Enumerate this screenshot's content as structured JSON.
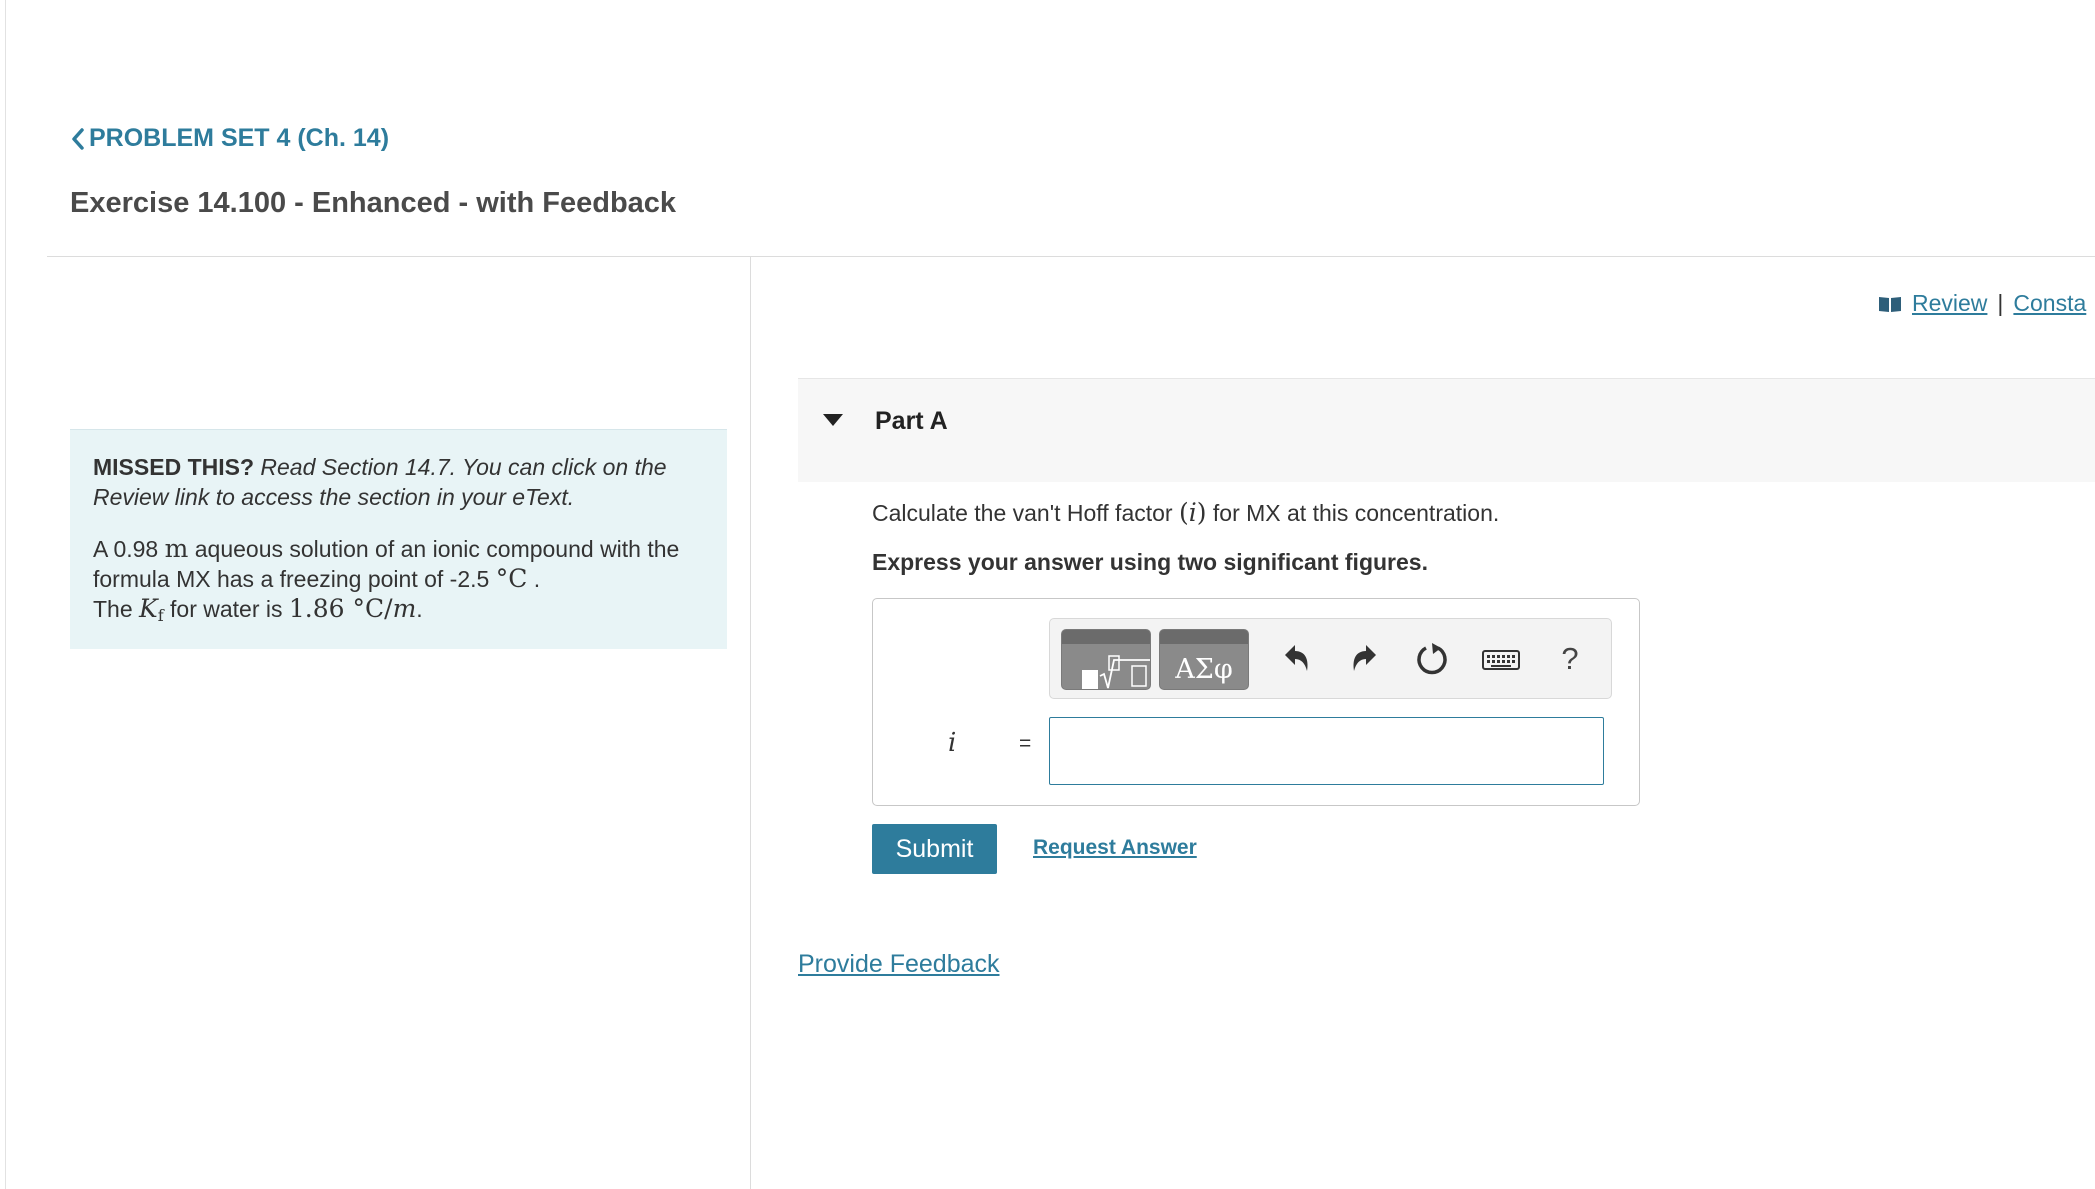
{
  "breadcrumb": {
    "label": "PROBLEM SET 4 (Ch. 14)"
  },
  "page_title": "Exercise 14.100 - Enhanced - with Feedback",
  "missed": {
    "label": "MISSED THIS?",
    "hint": "Read Section 14.7. You can click on the Review link to access the section in your eText.",
    "problem_part1": "A 0.98 ",
    "molality_unit": "m",
    "problem_part2": " aqueous solution of an ionic compound with the formula MX has a freezing point of -2.5 ",
    "fp_unit": "°C",
    "problem_part3": " .",
    "kf_prefix": "The ",
    "kf_symbol": "K",
    "kf_subscript": "f",
    "kf_middle": " for water is ",
    "kf_value": "1.86 °C/",
    "kf_value_unit": "m",
    "kf_end": "."
  },
  "review_links": {
    "review": "Review",
    "separator": "|",
    "constants": "Consta"
  },
  "part": {
    "title": "Part A"
  },
  "question": {
    "prefix": "Calculate the van't Hoff factor ",
    "symbol_open": "(",
    "symbol": "i",
    "symbol_close": ")",
    "suffix": " for MX at this concentration."
  },
  "instruction": "Express your answer using two significant figures.",
  "answer": {
    "variable": "i",
    "equals": "=",
    "value": ""
  },
  "toolbar": {
    "symbols_label": "ΑΣφ",
    "help_label": "?",
    "icons": [
      "templates-icon",
      "greek-symbols-icon",
      "undo-icon",
      "redo-icon",
      "reset-icon",
      "keyboard-icon",
      "help-icon"
    ]
  },
  "buttons": {
    "submit": "Submit",
    "request_answer": "Request Answer"
  },
  "feedback_link": "Provide Feedback",
  "colors": {
    "accent": "#2e7c9c",
    "hint_bg": "#e8f4f6",
    "part_bg": "#f7f7f7"
  }
}
